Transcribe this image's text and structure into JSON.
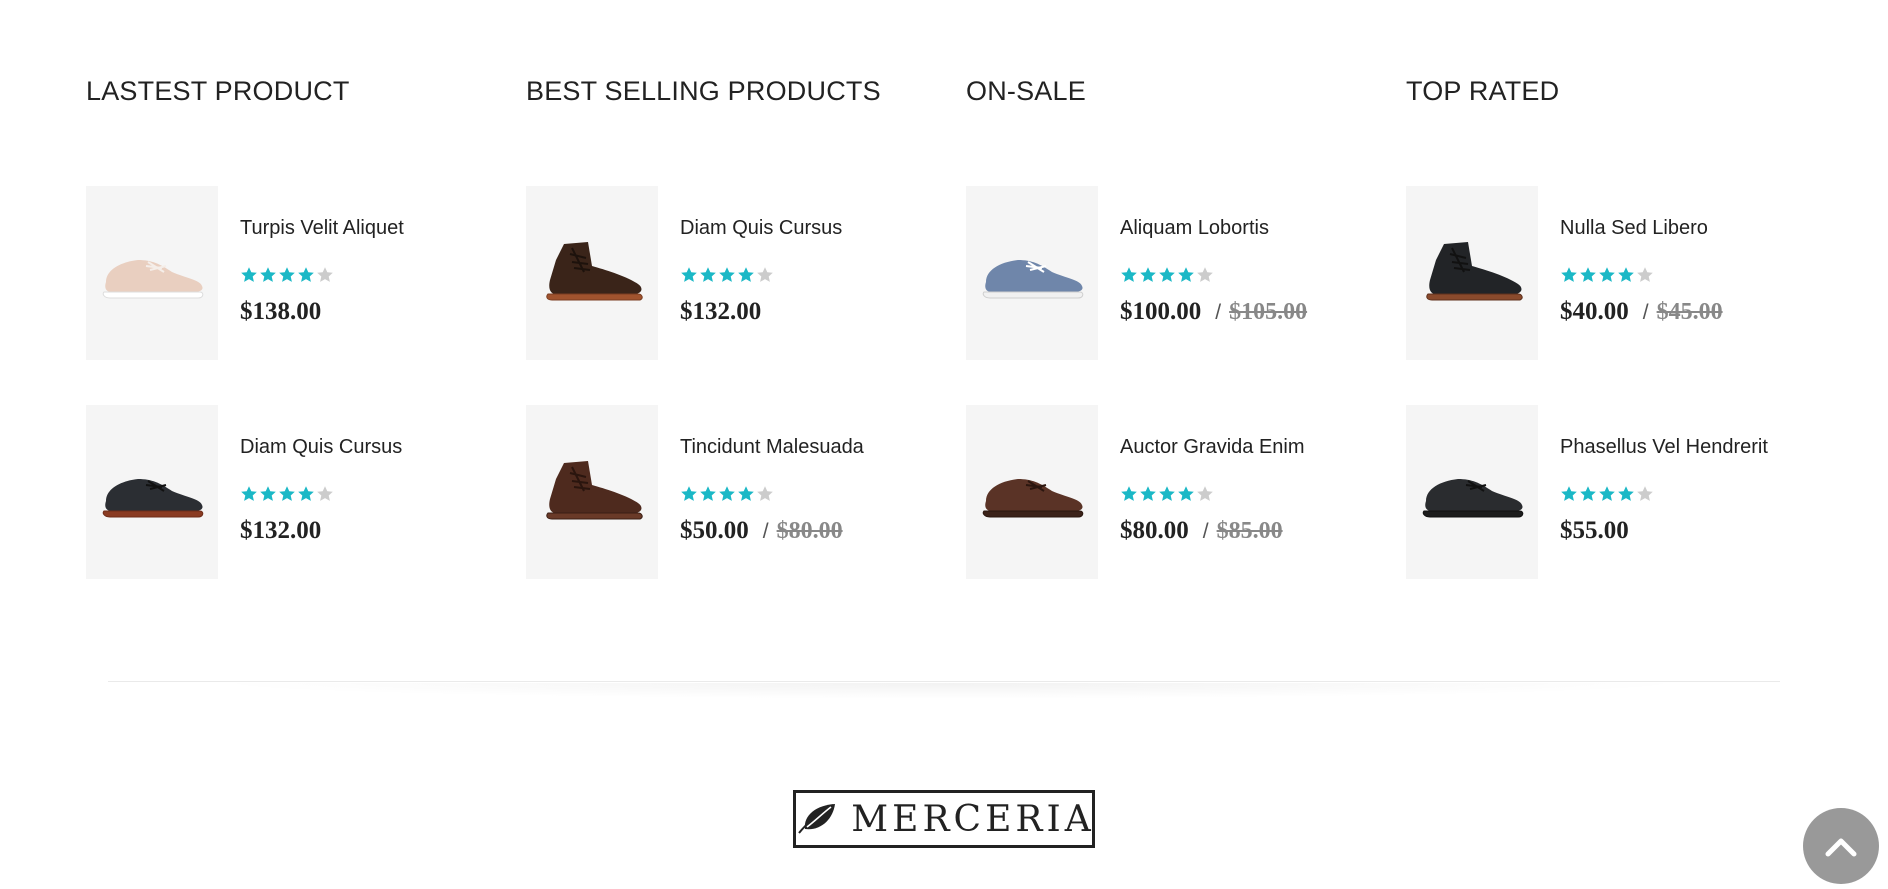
{
  "accent_color": "#1bb8c6",
  "star_empty_color": "#cccccc",
  "columns": [
    {
      "title": "LASTEST PRODUCT",
      "products": [
        {
          "name": "Turpis Velit Aliquet",
          "rating": 4,
          "price": "$138.00",
          "old_price": null,
          "image": "beige-sneaker"
        },
        {
          "name": "Diam Quis Cursus",
          "rating": 4,
          "price": "$132.00",
          "old_price": null,
          "image": "black-derby-shoe"
        }
      ]
    },
    {
      "title": "BEST SELLING PRODUCTS",
      "products": [
        {
          "name": "Diam Quis Cursus",
          "rating": 4,
          "price": "$132.00",
          "old_price": null,
          "image": "brown-suede-chukka-boot"
        },
        {
          "name": "Tincidunt Malesuada",
          "rating": 4,
          "price": "$50.00",
          "old_price": "$80.00",
          "image": "brown-leather-boot"
        }
      ]
    },
    {
      "title": "ON-SALE",
      "products": [
        {
          "name": "Aliquam Lobortis",
          "rating": 4,
          "price": "$100.00",
          "old_price": "$105.00",
          "image": "blue-canvas-sneaker"
        },
        {
          "name": "Auctor Gravida Enim",
          "rating": 4,
          "price": "$80.00",
          "old_price": "$85.00",
          "image": "brown-derby-shoe"
        }
      ]
    },
    {
      "title": "TOP RATED",
      "products": [
        {
          "name": "Nulla Sed Libero",
          "rating": 4,
          "price": "$40.00",
          "old_price": "$45.00",
          "image": "black-brogue-boot"
        },
        {
          "name": "Phasellus Vel Hendrerit",
          "rating": 4,
          "price": "$55.00",
          "old_price": null,
          "image": "black-brogue-shoe"
        }
      ]
    }
  ],
  "footer": {
    "logo_text": "MERCERIA",
    "logo_icon": "leaf-icon",
    "back_to_top_icon": "chevron-up-icon"
  }
}
